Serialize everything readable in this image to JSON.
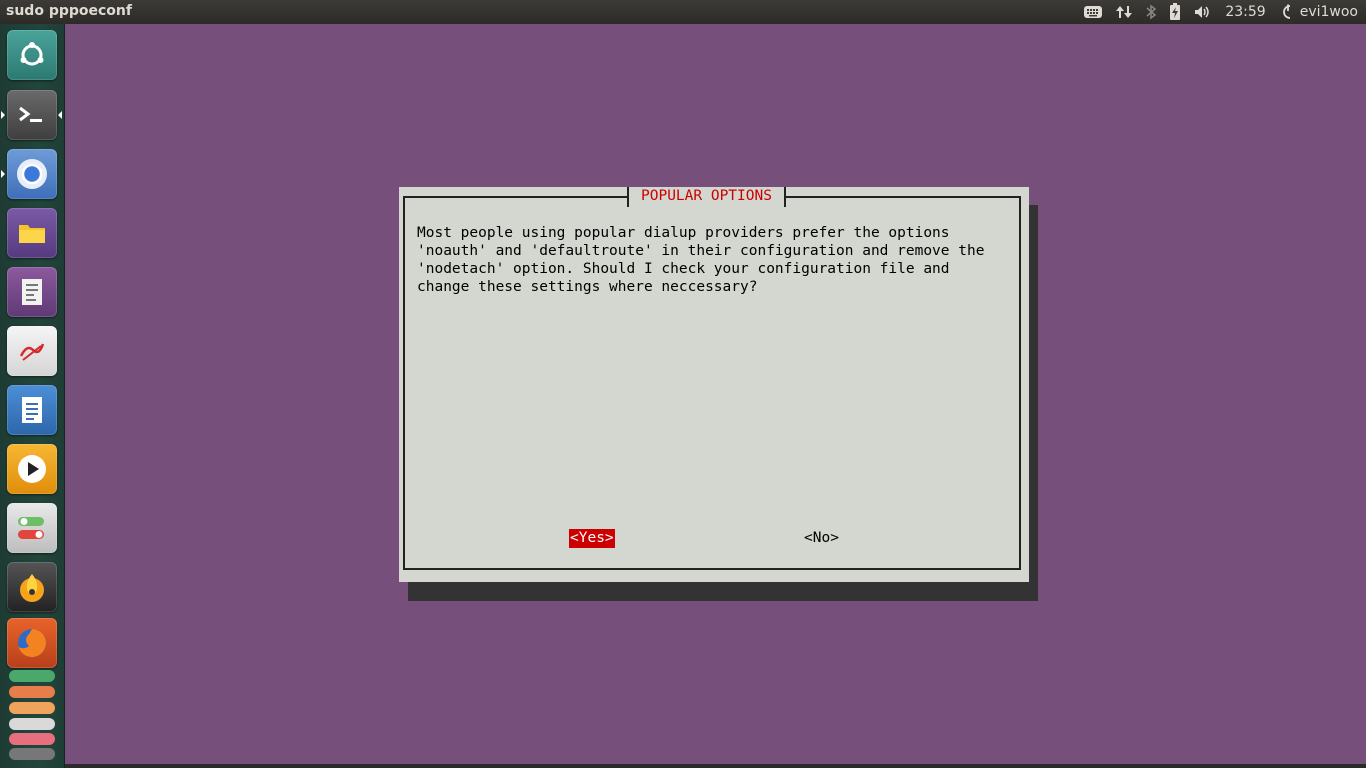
{
  "top_panel": {
    "window_title": "sudo pppoeconf",
    "clock": "23:59",
    "user": "evi1woo",
    "icons": [
      "keyboard-icon",
      "network-transfer-icon",
      "bluetooth-icon",
      "battery-icon",
      "volume-icon",
      "session-icon"
    ]
  },
  "launcher": {
    "items": [
      "ubuntu-dash-icon",
      "terminal-icon",
      "chromium-icon",
      "files-icon",
      "document-viewer-icon",
      "text-editor-signature-icon",
      "writer-icon",
      "media-player-icon",
      "switch-toggles-icon",
      "burner-flame-icon",
      "firefox-icon"
    ]
  },
  "dialog": {
    "title": "POPULAR OPTIONS",
    "message": "Most people using popular dialup providers prefer the options\n'noauth' and 'defaultroute' in their configuration and remove the\n'nodetach' option. Should I check your configuration file and\nchange these settings where neccessary?",
    "yes_label": "<Yes>",
    "no_label": "<No>"
  },
  "colors": {
    "terminal_bg": "#764f7b",
    "dialog_bg": "#d3d7cf",
    "title_red": "#cc0000",
    "selected_button": "#cc0000"
  }
}
